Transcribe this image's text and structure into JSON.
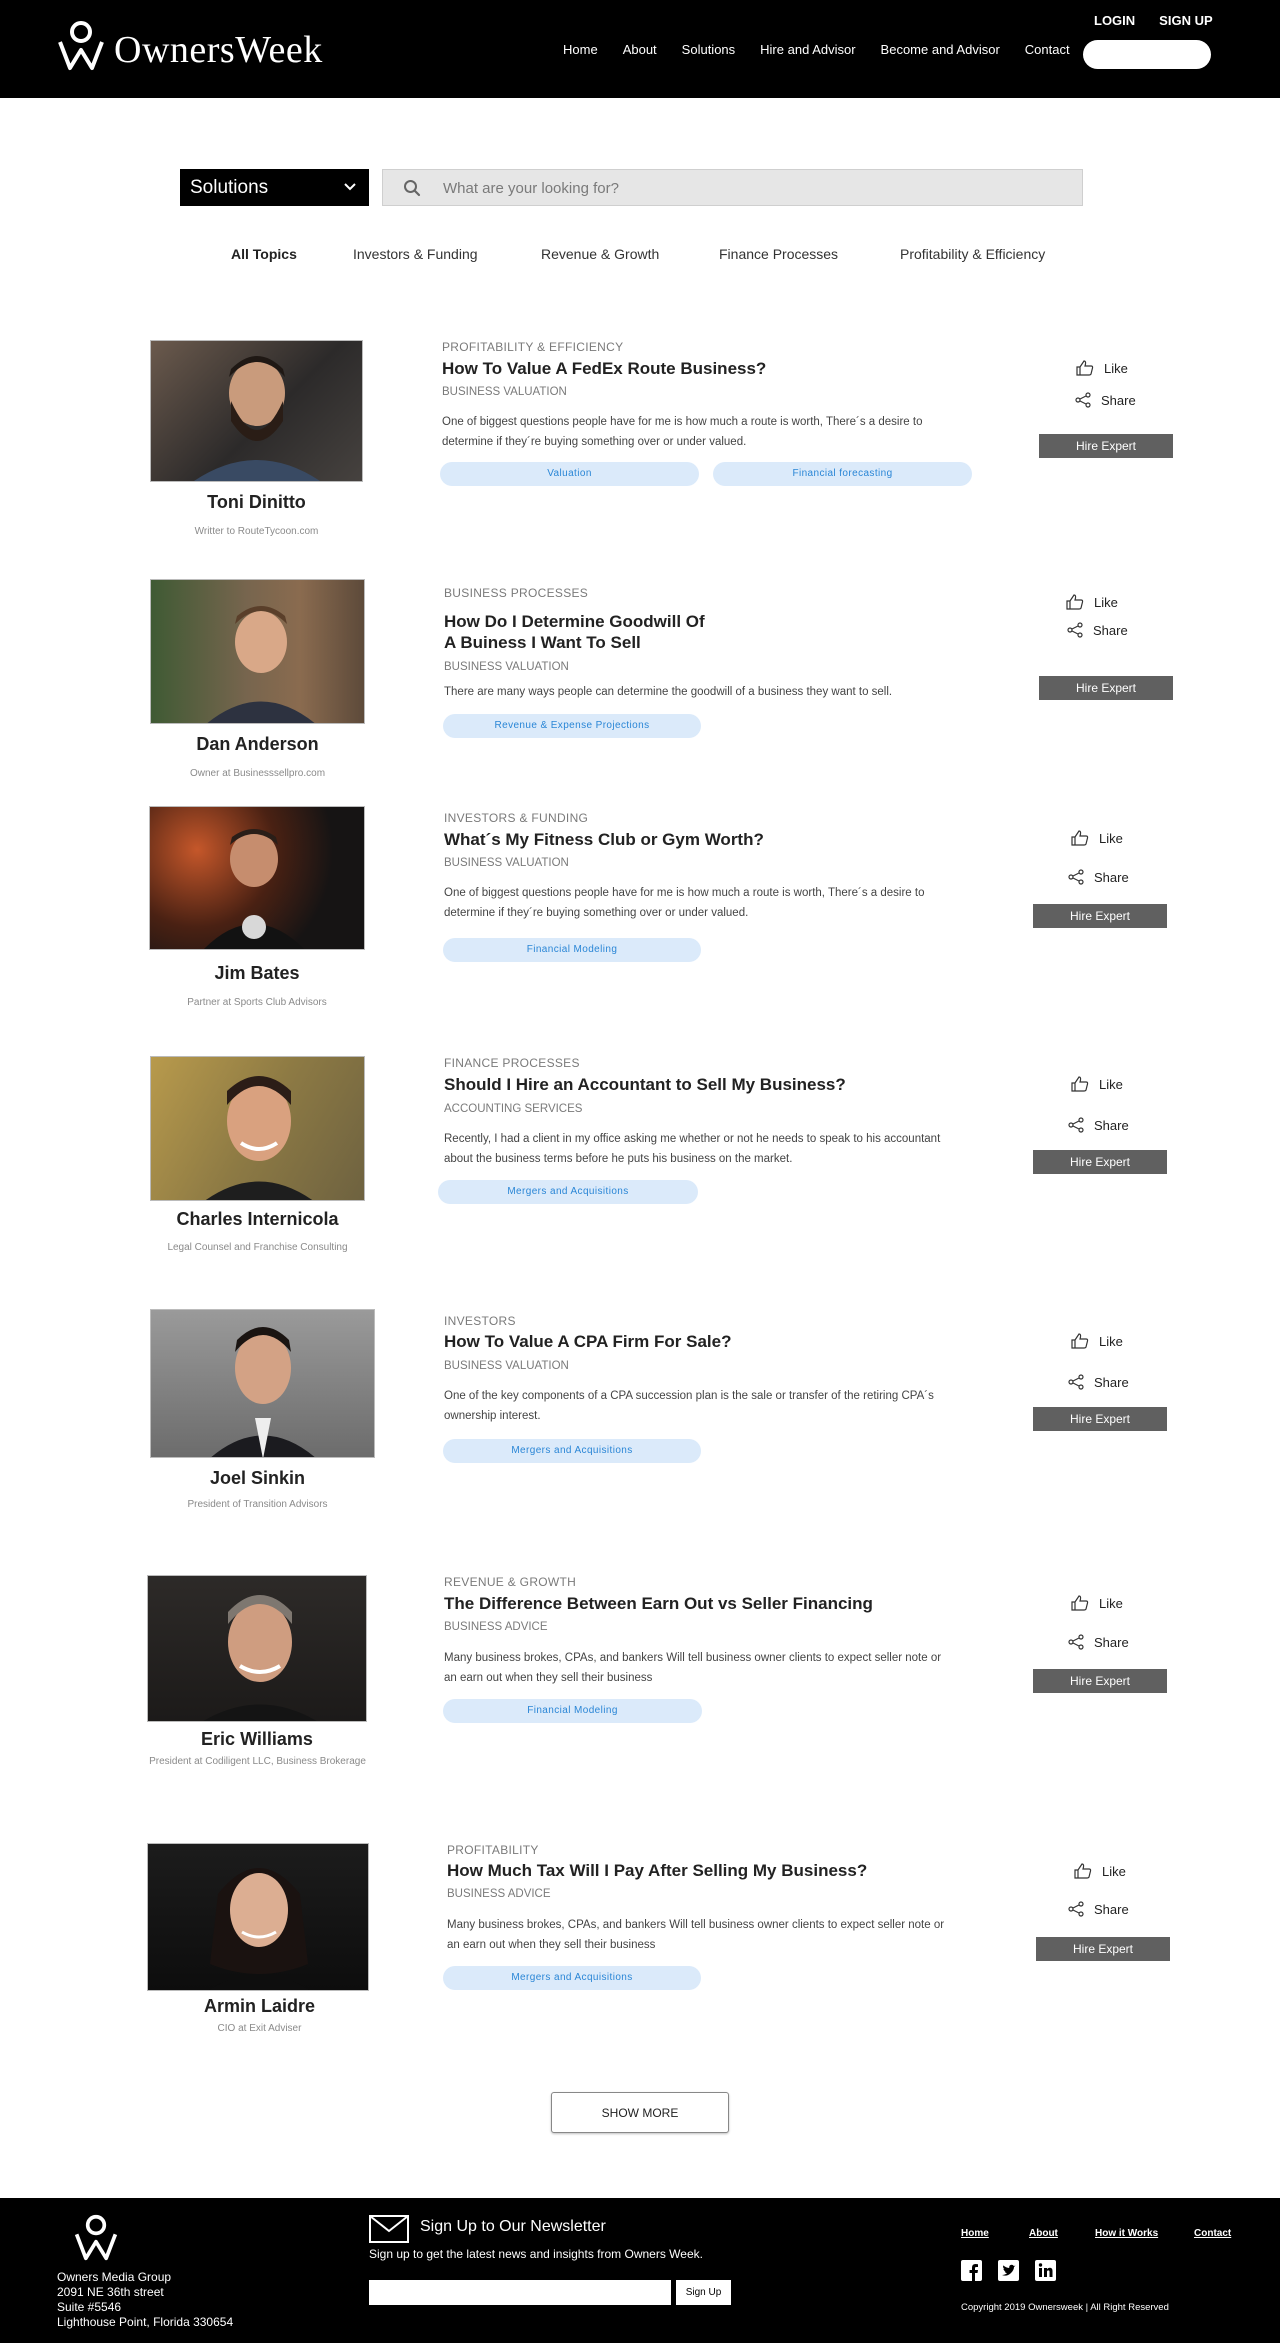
{
  "header": {
    "brand": "OwnersWeek",
    "nav": [
      "Home",
      "About",
      "Solutions",
      "Hire and Advisor",
      "Become and Advisor",
      "Contact"
    ],
    "login": "LOGIN",
    "signup": "SIGN UP"
  },
  "search": {
    "dropdown_value": "Solutions",
    "placeholder": "What are your looking for?"
  },
  "topics": [
    "All Topics",
    "Investors & Funding",
    "Revenue & Growth",
    "Finance Processes",
    "Profitability & Efficiency"
  ],
  "actions": {
    "like": "Like",
    "share": "Share",
    "hire": "Hire Expert"
  },
  "posts": [
    {
      "name": "Toni Dinitto",
      "role": "Writter to RouteTycoon.com",
      "category": "PROFITABILITY & EFFICIENCY",
      "title": "How To Value A FedEx Route Business?",
      "subcategory": "BUSINESS VALUATION",
      "excerpt": "One of biggest questions people have for me is how much a route is worth, There´s a desire to determine if they´re buying something over or under valued.",
      "tags": [
        "Valuation",
        "Financial forecasting"
      ]
    },
    {
      "name": "Dan Anderson",
      "role": "Owner at Businesssellpro.com",
      "category": "BUSINESS PROCESSES",
      "title": "How Do I Determine Goodwill Of A Buiness I Want To Sell",
      "subcategory": "BUSINESS VALUATION",
      "excerpt": "There are many ways people can determine the goodwill of a business they want to sell.",
      "tags": [
        "Revenue & Expense Projections"
      ]
    },
    {
      "name": "Jim Bates",
      "role": "Partner at Sports Club Advisors",
      "category": "INVESTORS & FUNDING",
      "title": "What´s My Fitness Club or Gym Worth?",
      "subcategory": "BUSINESS VALUATION",
      "excerpt": "One of biggest questions people have for me is how much a route is worth, There´s a desire to determine if they´re buying something over or under valued.",
      "tags": [
        "Financial Modeling"
      ]
    },
    {
      "name": "Charles Internicola",
      "role": "Legal Counsel and Franchise Consulting",
      "category": "FINANCE PROCESSES",
      "title": "Should I Hire an Accountant to Sell My Business?",
      "subcategory": "ACCOUNTING SERVICES",
      "excerpt": "Recently, I had a client in my office  asking me whether or not he needs to speak to his accountant about the business terms before he puts his business on the market.",
      "tags": [
        "Mergers and Acquisitions"
      ]
    },
    {
      "name": "Joel Sinkin",
      "role": "President of Transition Advisors",
      "category": "INVESTORS",
      "title": "How To Value A CPA Firm For Sale?",
      "subcategory": "BUSINESS VALUATION",
      "excerpt": "One of the key components of a CPA succession plan is the sale or transfer of the retiring CPA´s ownership interest.",
      "tags": [
        "Mergers and Acquisitions"
      ]
    },
    {
      "name": "Eric Williams",
      "role": "President at Codiligent LLC, Business Brokerage",
      "category": "REVENUE & GROWTH",
      "title": "The Difference Between Earn Out vs Seller Financing",
      "subcategory": "BUSINESS ADVICE",
      "excerpt": "Many business brokes, CPAs, and bankers Will tell business owner clients to expect seller note or an earn out when they sell their business",
      "tags": [
        "Financial Modeling"
      ]
    },
    {
      "name": "Armin Laidre",
      "role": "CIO at Exit Adviser",
      "category": "PROFITABILITY",
      "title": "How Much Tax Will I Pay After Selling My Business?",
      "subcategory": "BUSINESS ADVICE",
      "excerpt": "Many business brokes, CPAs, and bankers Will tell business owner clients to expect seller note or an earn out when they sell their business",
      "tags": [
        "Mergers and Acquisitions"
      ]
    }
  ],
  "show_more": "SHOW MORE",
  "footer": {
    "address": [
      "Owners Media Group",
      "2091 NE 36th street",
      "Suite #5546",
      "Lighthouse Point, Florida 330654"
    ],
    "newsletter_title": "Sign Up to Our Newsletter",
    "newsletter_sub": "Sign up to get the latest news and insights from Owners Week.",
    "signup_button": "Sign Up",
    "links": [
      "Home",
      "About",
      "How it Works",
      "Contact"
    ],
    "copyright": "Copyright 2019 Ownersweek | All Right Reserved"
  }
}
